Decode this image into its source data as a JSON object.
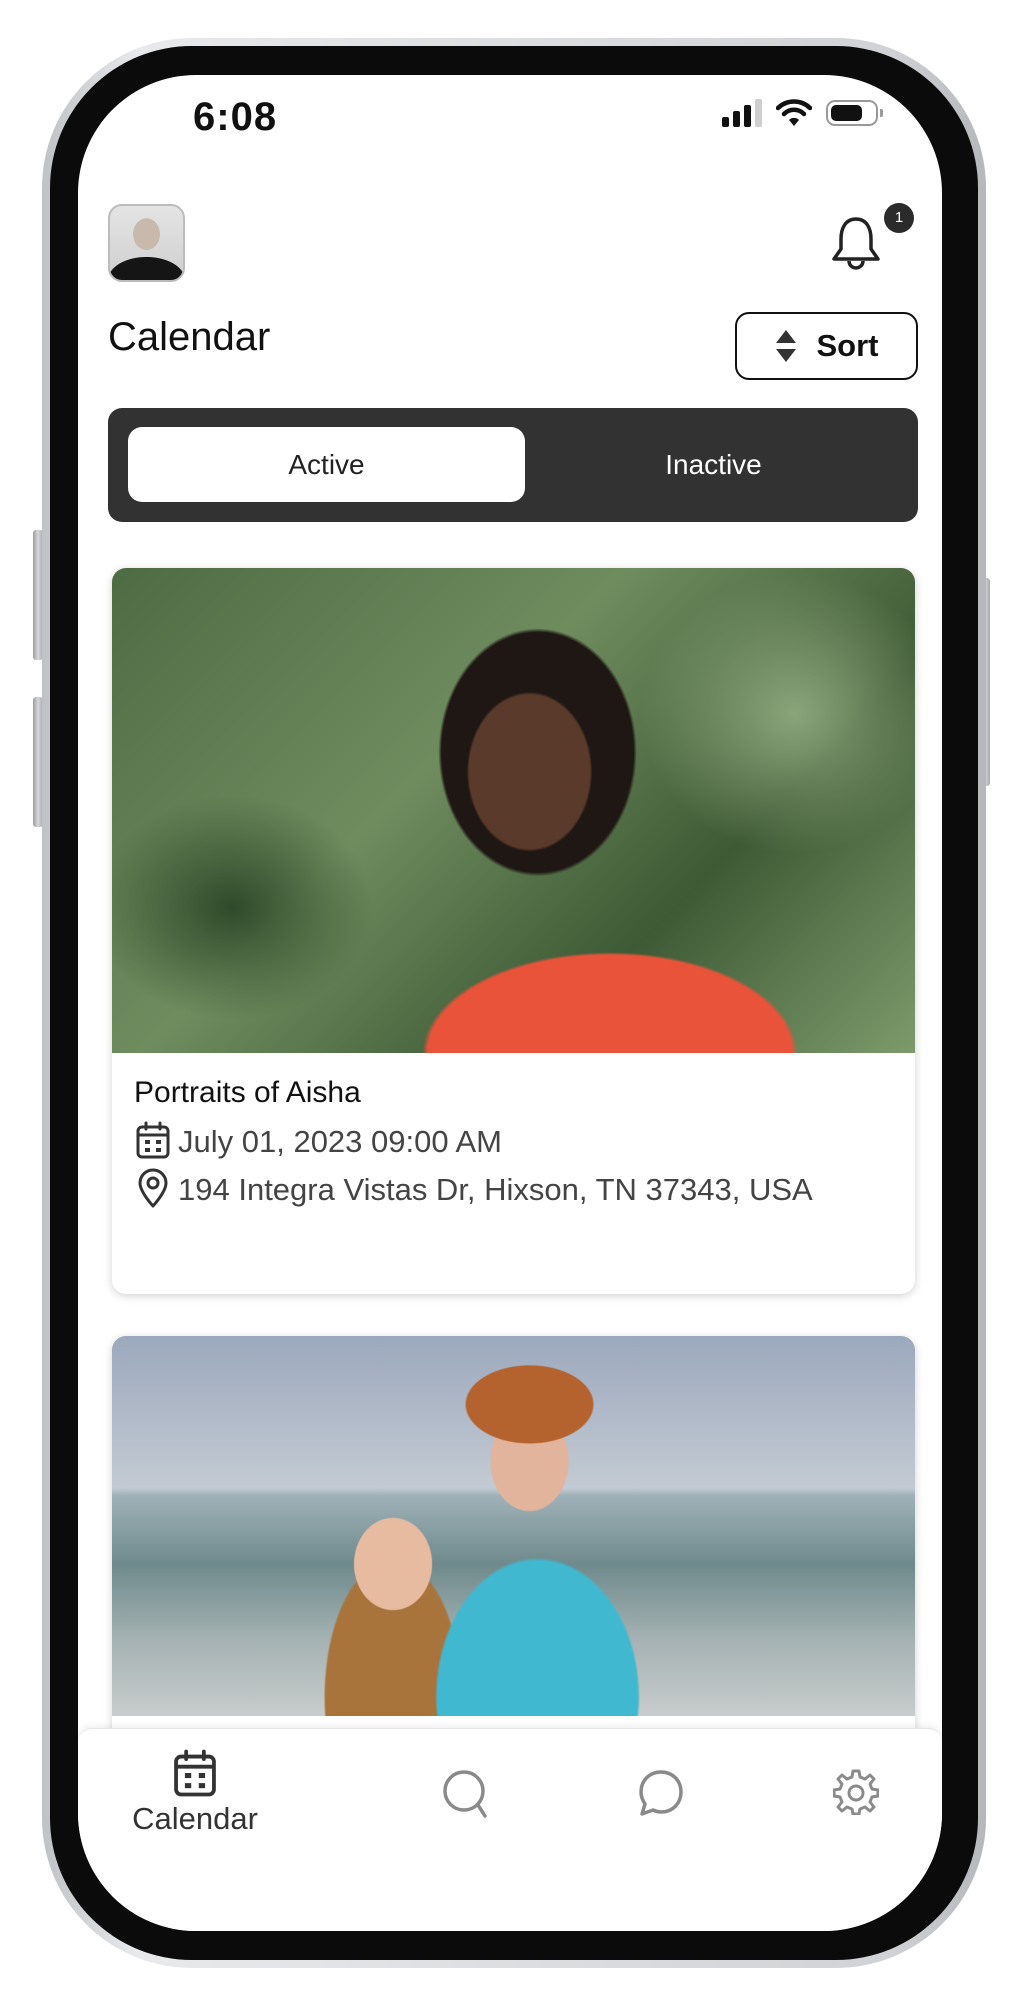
{
  "status_bar": {
    "time": "6:08",
    "signal_bars_filled": 3,
    "signal_bars_total": 4,
    "battery_level": 0.65,
    "icons": [
      "signal-icon",
      "wifi-icon",
      "battery-icon"
    ]
  },
  "header": {
    "avatar_alt": "User avatar",
    "notification_count": "1",
    "title": "Calendar",
    "sort_label": "Sort"
  },
  "segmented": {
    "tabs": [
      {
        "label": "Active",
        "selected": true
      },
      {
        "label": "Inactive",
        "selected": false
      }
    ]
  },
  "events": [
    {
      "title": "Portraits of Aisha",
      "datetime": "July 01, 2023 09:00 AM",
      "location": "194 Integra Vistas Dr, Hixson, TN 37343, USA",
      "photo": "portrait-woman-glasses-red-shirt"
    },
    {
      "photo": "couple-on-beach"
    }
  ],
  "tabbar": {
    "items": [
      {
        "label": "Calendar",
        "icon": "calendar-icon",
        "active": true
      },
      {
        "label": "",
        "icon": "search-icon",
        "active": false
      },
      {
        "label": "",
        "icon": "chat-icon",
        "active": false
      },
      {
        "label": "",
        "icon": "gear-icon",
        "active": false
      }
    ]
  },
  "colors": {
    "segment_bg": "#323232",
    "text_primary": "#111111",
    "text_secondary": "#444444",
    "inactive_icon": "#8a8a8a"
  }
}
